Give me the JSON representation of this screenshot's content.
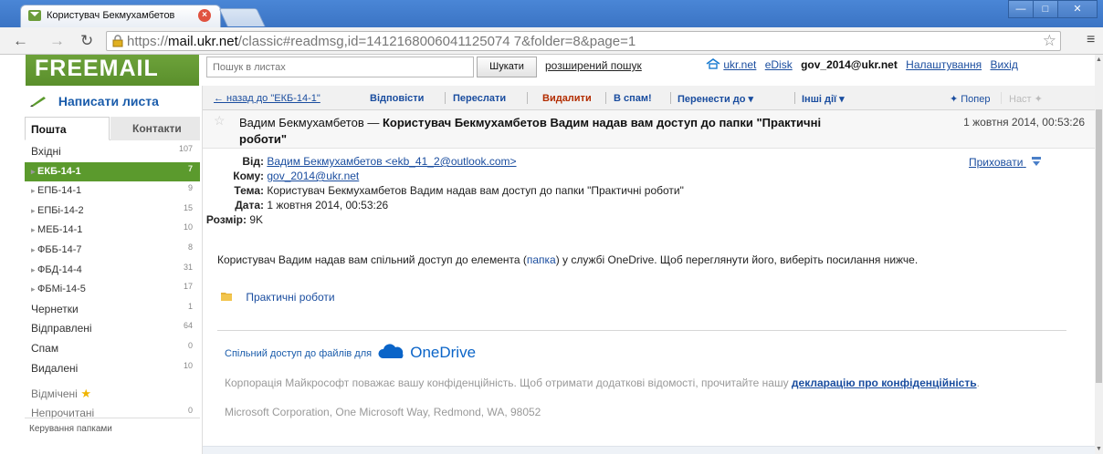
{
  "browser": {
    "tab_title": "Користувач Бекмухамбетов",
    "url_prefix": "https://",
    "url_domain": "mail.ukr.net",
    "url_path": "/classic#readmsg,id=1412168006041125074 7&folder=8&page=1",
    "window_buttons": [
      "—",
      "□",
      "✕"
    ]
  },
  "header": {
    "logo": "FREEMAIL",
    "search_placeholder": "Пошук в листах",
    "search_button": "Шукати",
    "advanced_search": "розширений пошук",
    "links": {
      "ukrnet": "ukr.net",
      "edisk": "eDisk",
      "account": "gov_2014@ukr.net",
      "settings": "Налаштування",
      "logout": "Вихід"
    }
  },
  "sidebar": {
    "compose": "Написати листа",
    "tabs": [
      "Пошта",
      "Контакти"
    ],
    "folders": [
      {
        "label": "Вхідні",
        "count": "107",
        "type": "top"
      },
      {
        "label": "ЕКБ-14-1",
        "count": "7",
        "type": "sub",
        "active": true
      },
      {
        "label": "ЕПБ-14-1",
        "count": "9",
        "type": "sub"
      },
      {
        "label": "ЕПБі-14-2",
        "count": "15",
        "type": "sub"
      },
      {
        "label": "МЕБ-14-1",
        "count": "10",
        "type": "sub"
      },
      {
        "label": "ФББ-14-7",
        "count": "8",
        "type": "sub"
      },
      {
        "label": "ФБД-14-4",
        "count": "31",
        "type": "sub"
      },
      {
        "label": "ФБМі-14-5",
        "count": "17",
        "type": "sub"
      },
      {
        "label": "Чернетки",
        "count": "1",
        "type": "top"
      },
      {
        "label": "Відправлені",
        "count": "64",
        "type": "top"
      },
      {
        "label": "Спам",
        "count": "0",
        "type": "top"
      },
      {
        "label": "Видалені",
        "count": "10",
        "type": "top"
      },
      {
        "label": "Відмічені",
        "count": "",
        "type": "starred"
      },
      {
        "label": "Непрочитані",
        "count": "0",
        "type": "faded"
      }
    ],
    "manage_folders": "Керування папками"
  },
  "toolbar": {
    "back": "← назад до \"ЕКБ-14-1\"",
    "reply": "Відповісти",
    "forward": "Переслати",
    "delete": "Видалити",
    "spam": "В спам!",
    "move": "Перенести до ▾",
    "other": "Інші дії ▾",
    "prev": "✦ Попер",
    "next": "Наст ✦"
  },
  "message": {
    "sender_name": "Вадим Бекмухамбетов",
    "subject_bold": "Користувач Бекмухамбетов Вадим надав вам доступ до папки \"Практичні роботи\"",
    "date_short": "1 жовтня 2014, 00:53:26",
    "from_label": "Від:",
    "from_value": "Вадим Бекмухамбетов <ekb_41_2@outlook.com>",
    "to_label": "Кому:",
    "to_value": "gov_2014@ukr.net",
    "subject_label": "Тема:",
    "subject_value": "Користувач Бекмухамбетов Вадим надав вам доступ до папки \"Практичні роботи\"",
    "date_label": "Дата:",
    "date_value": "1 жовтня 2014, 00:53:26",
    "size_label": "Розмір:",
    "size_value": "9K",
    "hide": "Приховати",
    "body_before": "Користувач Вадим надав вам спільний доступ до елемента (",
    "body_link": "папка",
    "body_after": ") у службі OneDrive. Щоб переглянути його, виберіть посилання нижче.",
    "folder_name": "Практичні роботи",
    "onedrive_prefix": "Спільний доступ до файлів для",
    "onedrive_brand": "OneDrive",
    "privacy_text": "Корпорація Майкрософт поважає вашу конфіденційність. Щоб отримати додаткові відомості, прочитайте нашу ",
    "privacy_link": "декларацію про конфіденційність",
    "privacy_end": ".",
    "ms_address": "Microsoft Corporation, One Microsoft Way, Redmond, WA, 98052"
  },
  "colors": {
    "brand_green": "#5b9a2d",
    "link_blue": "#1a4d9f",
    "delete_red": "#b32d00"
  }
}
